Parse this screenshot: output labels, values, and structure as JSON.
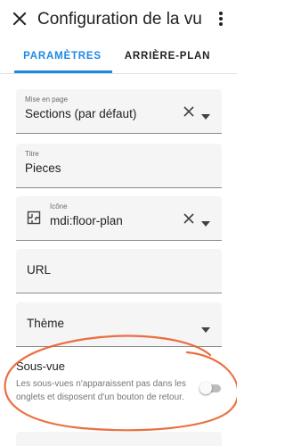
{
  "appbar": {
    "title": "Configuration de la vu",
    "close_icon": "close-icon",
    "more_icon": "more-vertical-icon"
  },
  "tabs": [
    {
      "label": "PARAMÈTRES",
      "active": true
    },
    {
      "label": "ARRIÈRE-PLAN",
      "active": false
    }
  ],
  "fields": {
    "layout": {
      "label": "Mise en page",
      "value": "Sections (par défaut)"
    },
    "title": {
      "label": "Titre",
      "value": "Pieces"
    },
    "icon": {
      "label": "Icône",
      "value": "mdi:floor-plan",
      "icon": "floor-plan-icon"
    },
    "url": {
      "placeholder": "URL"
    },
    "theme": {
      "placeholder": "Thème"
    }
  },
  "subview": {
    "title": "Sous-vue",
    "description": "Les sous-vues n'apparaissent pas dans les onglets et disposent d'un bouton de retour.",
    "enabled": false
  },
  "colors": {
    "accent": "#1e88e5",
    "annotation": "#e8612c",
    "field_bg": "#f5f5f5"
  }
}
